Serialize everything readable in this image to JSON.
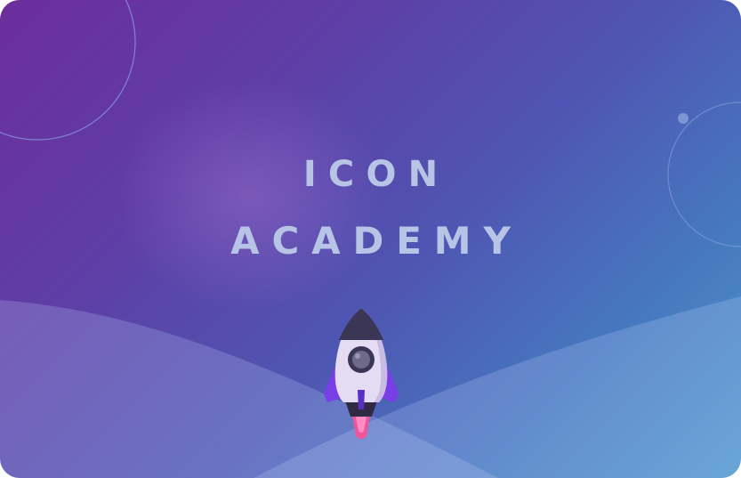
{
  "banner": {
    "title_line_1": "ICON",
    "title_line_2": "ACADEMY",
    "illustration_icon": "rocket-icon"
  },
  "colors": {
    "gradient_start": "#6c2d9c",
    "gradient_mid": "#4f55b2",
    "gradient_end": "#4f99cc",
    "title_text": "#b7c4e6",
    "rocket_body": "#e4dcf3",
    "rocket_fins": "#7a3ee6",
    "rocket_nose": "#3c3656",
    "rocket_flame": "#f0549b"
  }
}
